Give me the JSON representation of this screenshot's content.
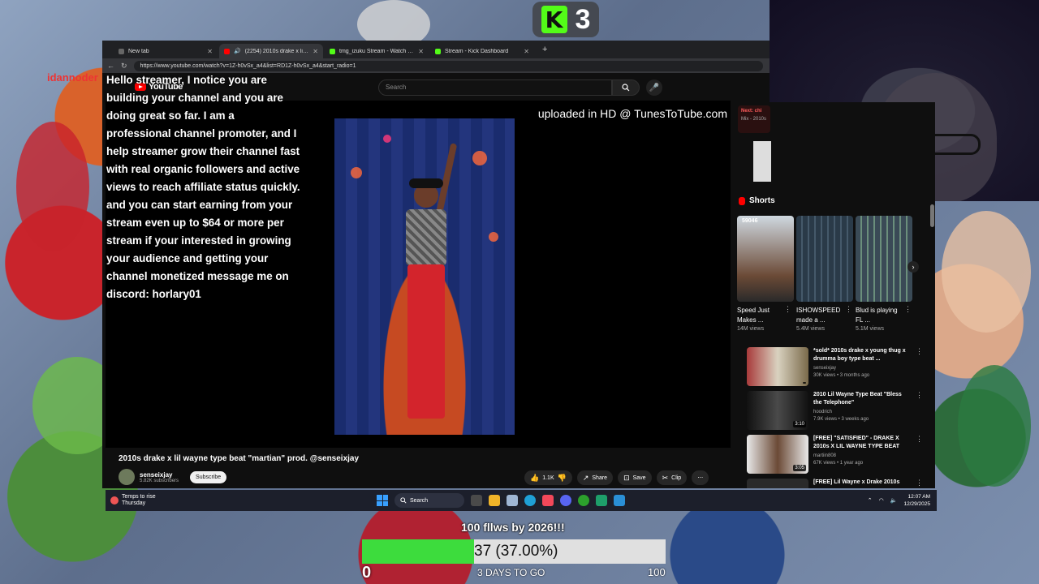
{
  "overlay": {
    "bg_name_tag": "idannoder",
    "kick_count": "3",
    "spam_message": "Hello streamer, I notice you are building your channel and you are doing great so far. I am a professional channel promoter, and I help streamer grow their channel fast with real organic followers and active views to reach affiliate status quickly. and you can start earning from your stream even up to $64 or more per stream if your interested in growing your audience and getting your channel monetized message me on discord: horlary01",
    "goal": {
      "title": "100 fllws by 2026!!!",
      "progress_text": "37 (37.00%)",
      "progress_fraction": 0.37,
      "min": "0",
      "max": "100",
      "days_left": "3 DAYS TO GO"
    }
  },
  "browser": {
    "tabs": [
      {
        "label": "New tab",
        "color": "#666"
      },
      {
        "label": "(2254) 2010s drake x lil wayne",
        "color": "#ff0000"
      },
      {
        "label": "tmg_izuku Stream - Watch Live on",
        "color": "#53fc18"
      },
      {
        "label": "Stream - Kick Dashboard",
        "color": "#53fc18"
      }
    ],
    "url": "https://www.youtube.com/watch?v=1Z-h0vSx_a4&list=RD1Z-h0vSx_a4&start_radio=1"
  },
  "youtube": {
    "logo": "YouTube",
    "search_placeholder": "Search",
    "video_watermark": "uploaded in HD @ TunesToTube.com",
    "video_title": "2010s drake x lil wayne type beat \"martian\" prod. @senseixjay",
    "channel": {
      "name": "senseixjay",
      "subs": "5.82K subscribers",
      "subscribe": "Subscribe"
    },
    "actions": {
      "likes": "1.1K",
      "share": "Share",
      "save": "Save",
      "clip": "Clip"
    },
    "next": {
      "title": "Next: chi",
      "sub": "Mix - 2010s"
    },
    "shorts_label": "Shorts",
    "shorts": [
      {
        "title": "Speed Just Makes ...",
        "views": "14M views",
        "badge": "59046"
      },
      {
        "title": "ISHOWSPEED made a ...",
        "views": "5.4M views",
        "badge": ""
      },
      {
        "title": "Blud is playing FL ...",
        "views": "5.1M views",
        "badge": ""
      }
    ],
    "recs": [
      {
        "title": "*sold* 2010s drake x young thug x drumma boy type beat ...",
        "channel": "senseixjay",
        "meta": "30K views • 3 months ago",
        "duration": ""
      },
      {
        "title": "2010 Lil Wayne Type Beat \"Bless the Telephone\"",
        "channel": "hoodrich",
        "meta": "7.9K views • 3 weeks ago",
        "duration": "3:10"
      },
      {
        "title": "[FREE] \"SATISFIED\" - DRAKE X 2010s X LIL WAYNE TYPE BEAT",
        "channel": "martiin808",
        "meta": "67K views • 1 year ago",
        "duration": "3:05"
      },
      {
        "title": "[FREE] Lil Wayne x Drake 2010s",
        "channel": "",
        "meta": "",
        "duration": ""
      }
    ]
  },
  "taskbar": {
    "weather_line1": "Temps to rise",
    "weather_line2": "Thursday",
    "search": "Search",
    "time": "12:07 AM",
    "date": "12/29/2025"
  }
}
